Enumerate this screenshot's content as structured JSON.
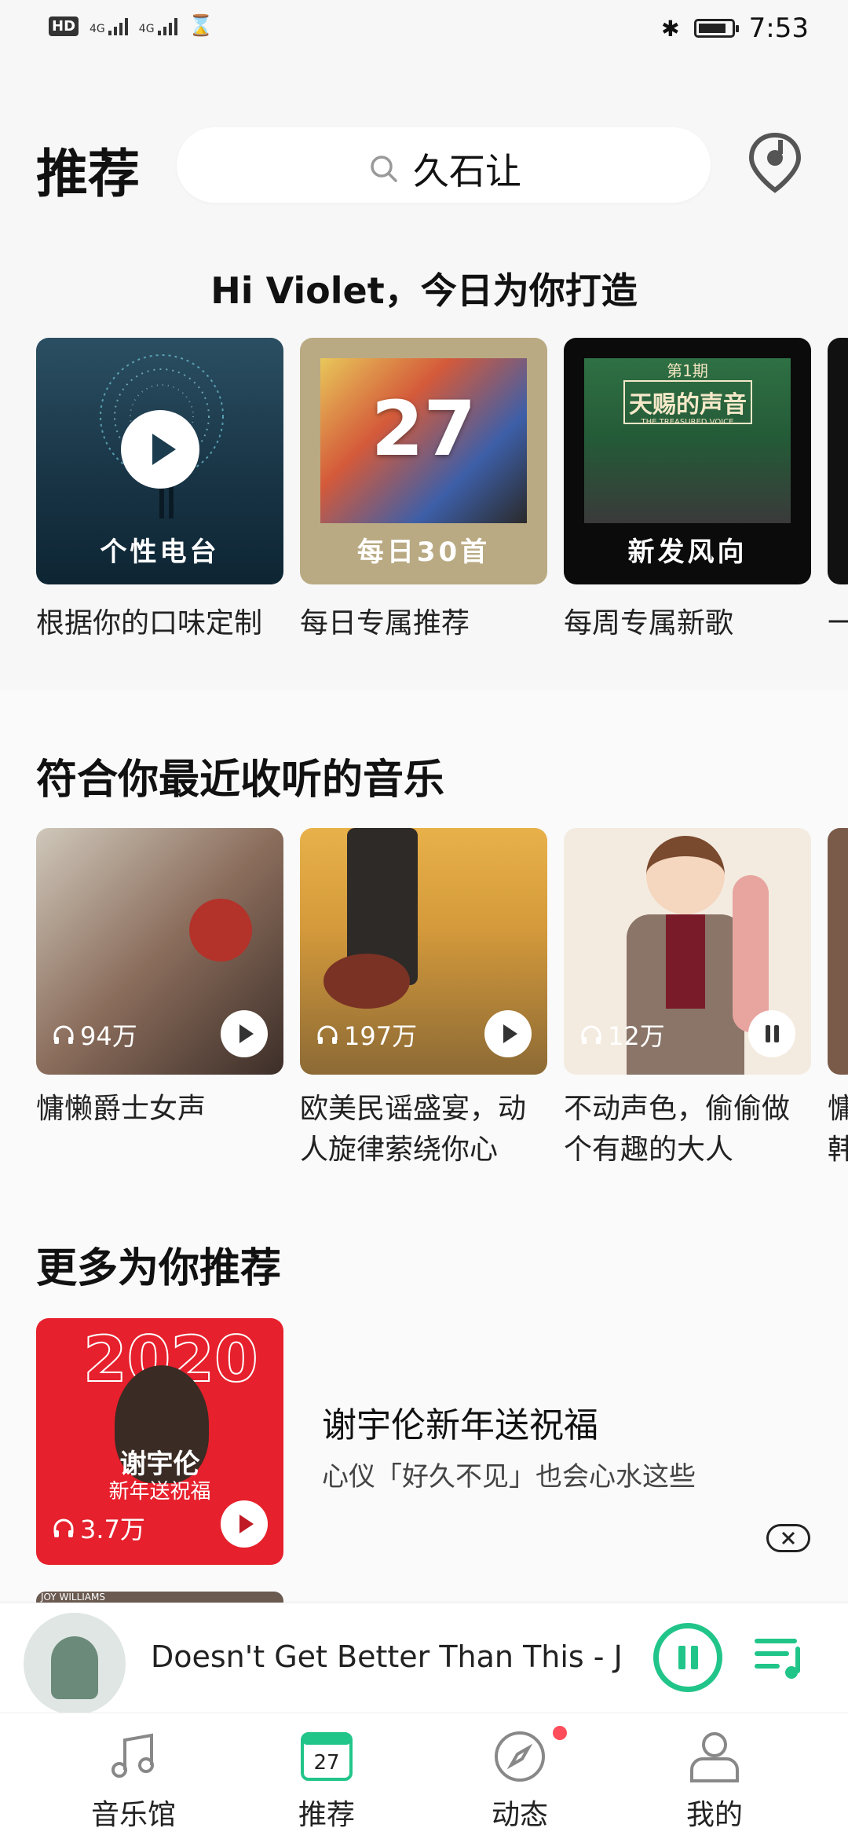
{
  "status_bar": {
    "left": [
      "HD",
      "4G",
      "4G"
    ],
    "time": "7:53",
    "battery_level": 0.85
  },
  "header": {
    "title": "推荐",
    "search_query": "久石让"
  },
  "greeting": "Hi Violet，今日为你打造",
  "daily_tiles": [
    {
      "caption": "个性电台",
      "subtitle": "根据你的口味定制"
    },
    {
      "caption": "每日30首",
      "subtitle": "每日专属推荐",
      "date_num": "27"
    },
    {
      "caption": "新发风向",
      "subtitle": "每周专属新歌",
      "art_text": "天赐的声音",
      "art_top": "第1期",
      "art_small": "THE TREASURED VOICE"
    },
    {
      "subtitle": "一"
    }
  ],
  "recent": {
    "title": "符合你最近收听的音乐",
    "cards": [
      {
        "plays": "94万",
        "title": "慵懒爵士女声",
        "state": "play"
      },
      {
        "plays": "197万",
        "title": "欧美民谣盛宴，动人旋律萦绕你心",
        "state": "play"
      },
      {
        "plays": "12万",
        "title": "不动声色，偷偷做个有趣的大人",
        "state": "pause"
      },
      {
        "title": "慵韩"
      }
    ]
  },
  "more": {
    "title": "更多为你推荐",
    "card": {
      "year": "2020",
      "artist": "谢宇伦",
      "tagline": "新年送祝福",
      "plays": "3.7万"
    },
    "item_title": "谢宇伦新年送祝福",
    "item_sub": "心仪「好久不见」也会心水这些",
    "next_cover_text": "JOY WILLIAMS"
  },
  "player": {
    "track": "Doesn't Get Better Than This - Joy"
  },
  "nav": [
    {
      "label": "音乐馆"
    },
    {
      "label": "推荐",
      "date": "27"
    },
    {
      "label": "动态"
    },
    {
      "label": "我的"
    }
  ],
  "colors": {
    "accent": "#21c589",
    "badge": "#ff4d5b"
  }
}
